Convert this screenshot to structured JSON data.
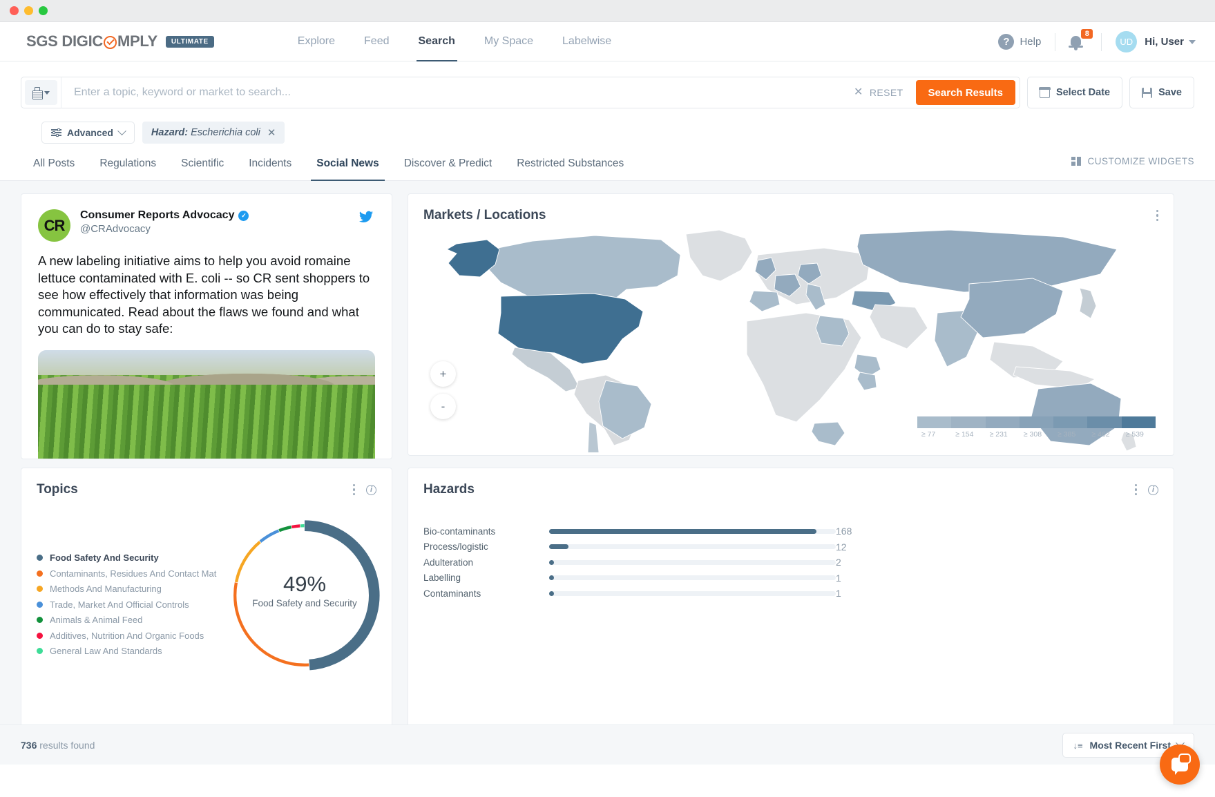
{
  "window": {
    "dots": [
      "red",
      "yellow",
      "green"
    ]
  },
  "brand": {
    "part1": "SGS DIGIC",
    "part2": "MPLY",
    "badge": "ULTIMATE"
  },
  "nav": {
    "items": [
      {
        "label": "Explore",
        "active": false
      },
      {
        "label": "Feed",
        "active": false
      },
      {
        "label": "Search",
        "active": true
      },
      {
        "label": "My Space",
        "active": false
      },
      {
        "label": "Labelwise",
        "active": false
      }
    ],
    "help_label": "Help",
    "notification_count": "8",
    "avatar_initials": "UD",
    "user_label": "Hi, User"
  },
  "search": {
    "placeholder": "Enter a topic, keyword or market to search...",
    "value": "",
    "reset_label": "RESET",
    "search_button": "Search Results",
    "select_date_button": "Select Date",
    "save_button": "Save"
  },
  "filters": {
    "advanced_label": "Advanced",
    "chip_key": "Hazard:",
    "chip_value": "Escherichia coli"
  },
  "tabs": {
    "items": [
      {
        "label": "All Posts",
        "active": false
      },
      {
        "label": "Regulations",
        "active": false
      },
      {
        "label": "Scientific",
        "active": false
      },
      {
        "label": "Incidents",
        "active": false
      },
      {
        "label": "Social News",
        "active": true
      },
      {
        "label": "Discover & Predict",
        "active": false
      },
      {
        "label": "Restricted Substances",
        "active": false
      }
    ],
    "customize_widgets": "CUSTOMIZE WIDGETS"
  },
  "tweet": {
    "avatar_initials": "CR",
    "display_name": "Consumer Reports Advocacy",
    "handle": "@CRAdvocacy",
    "text": "A new labeling initiative aims to help you avoid romaine lettuce contaminated with E. coli -- so CR sent shoppers to see how effectively that information was being communicated. Read about the flaws we found and what you can do to stay safe:"
  },
  "map": {
    "title": "Markets / Locations",
    "zoom_in": "+",
    "zoom_out": "-",
    "legend_ticks": [
      "≥ 77",
      "≥ 154",
      "≥ 231",
      "≥ 308",
      "≥ 385",
      "≥ 462",
      "≥ 539"
    ],
    "legend_colors": [
      "#a9bccb",
      "#9fb3c4",
      "#93aabe",
      "#87a2b8",
      "#7b9ab2",
      "#6b8ea9",
      "#4e7a9a"
    ]
  },
  "topics": {
    "title": "Topics",
    "center_value": "49%",
    "center_label": "Food Safety and Security"
  },
  "hazards": {
    "title": "Hazards"
  },
  "footer": {
    "results_count": "736",
    "results_label": "results found",
    "sort_label": "Most Recent First"
  },
  "chart_data": [
    {
      "type": "pie",
      "title": "Topics",
      "legend_position": "left",
      "categories": [
        "Food Safety And Security",
        "Contaminants, Residues And Contact Mat",
        "Methods And Manufacturing",
        "Trade, Market And Official Controls",
        "Animals & Animal Feed",
        "Additives, Nutrition And Organic Foods",
        "General Law And Standards"
      ],
      "values": [
        49,
        29,
        11,
        5,
        3,
        2,
        1
      ],
      "colors": [
        "#4a6e87",
        "#f4701f",
        "#f6a623",
        "#4a90d9",
        "#12913c",
        "#f5123f",
        "#3ddc97"
      ],
      "center_value": "49%",
      "center_label": "Food Safety and Security"
    },
    {
      "type": "bar",
      "title": "Hazards",
      "orientation": "horizontal",
      "categories": [
        "Bio-contaminants",
        "Process/logistic",
        "Adulteration",
        "Labelling",
        "Contaminants"
      ],
      "values": [
        168,
        12,
        2,
        1,
        1
      ],
      "max": 180,
      "bar_color": "#4a6e87",
      "track_color": "#eef2f6",
      "xlabel": "",
      "ylabel": ""
    },
    {
      "type": "heatmap",
      "title": "Markets / Locations",
      "subtype": "choropleth-world-map",
      "legend_ticks": [
        "≥ 77",
        "≥ 154",
        "≥ 231",
        "≥ 308",
        "≥ 385",
        "≥ 462",
        "≥ 539"
      ],
      "regions": [
        {
          "name": "United States",
          "bucket": 7
        },
        {
          "name": "Alaska",
          "bucket": 7
        },
        {
          "name": "Canada",
          "bucket": 3
        },
        {
          "name": "Russia",
          "bucket": 4
        },
        {
          "name": "China",
          "bucket": 4
        },
        {
          "name": "India",
          "bucket": 3
        },
        {
          "name": "Australia",
          "bucket": 4
        },
        {
          "name": "Brazil",
          "bucket": 3
        },
        {
          "name": "Chile",
          "bucket": 2
        },
        {
          "name": "Mexico",
          "bucket": 2
        },
        {
          "name": "United Kingdom",
          "bucket": 4
        },
        {
          "name": "France",
          "bucket": 4
        },
        {
          "name": "Spain",
          "bucket": 3
        },
        {
          "name": "Germany",
          "bucket": 4
        },
        {
          "name": "Italy",
          "bucket": 3
        },
        {
          "name": "Turkey",
          "bucket": 4
        },
        {
          "name": "South Africa",
          "bucket": 3
        },
        {
          "name": "Ethiopia",
          "bucket": 3
        },
        {
          "name": "Kenya",
          "bucket": 3
        },
        {
          "name": "Libya",
          "bucket": 3
        },
        {
          "name": "Japan",
          "bucket": 2
        },
        {
          "name": "Greenland",
          "bucket": 1
        }
      ]
    }
  ]
}
